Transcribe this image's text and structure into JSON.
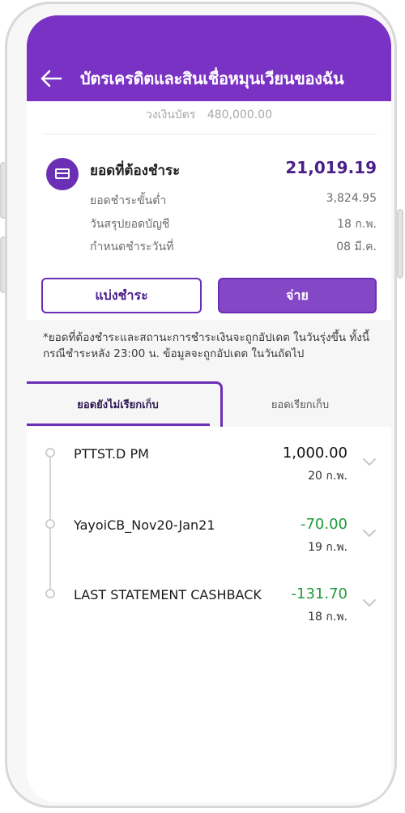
{
  "header": {
    "title": "บัตรเครดิตและสินเชื่อหมุนเวียนของฉัน"
  },
  "card": {
    "limit_label": "วงเงินบัตร",
    "limit_value": "480,000.00",
    "due_label": "ยอดที่ต้องชำระ",
    "due_amount": "21,019.19",
    "details": [
      {
        "label": "ยอดชำระขั้นต่ำ",
        "value": "3,824.95"
      },
      {
        "label": "วันสรุปยอดบัญชี",
        "value": "18 ก.พ."
      },
      {
        "label": "กำหนดชำระวันที่",
        "value": "08 มี.ค."
      }
    ],
    "installment_button": "แบ่งชำระ",
    "pay_button": "จ่าย"
  },
  "note": "*ยอดที่ต้องชำระและสถานะการชำระเงินจะถูกอัปเดต ในวันรุ่งขึ้น ทั้งนี้กรณีชำระหลัง 23:00 น. ข้อมูลจะถูกอัปเดต ในวันถัดไป",
  "tabs": [
    {
      "label": "ยอดยังไม่เรียกเก็บ",
      "active": true
    },
    {
      "label": "ยอดเรียกเก็บ",
      "active": false
    }
  ],
  "transactions": [
    {
      "name": "PTTST.D PM",
      "amount": "1,000.00",
      "date": "20 ก.พ."
    },
    {
      "name": "YayoiCB_Nov20-Jan21",
      "amount": "-70.00",
      "date": "19 ก.พ."
    },
    {
      "name": "LAST STATEMENT CASHBACK",
      "amount": "-131.70",
      "date": "18 ก.พ."
    }
  ],
  "colors": {
    "brand": "#7a32c4",
    "negative_amount": "#1f9a3a"
  },
  "icons": {
    "back": "arrow-left-icon",
    "card": "credit-card-icon",
    "expand": "chevron-down-icon"
  }
}
